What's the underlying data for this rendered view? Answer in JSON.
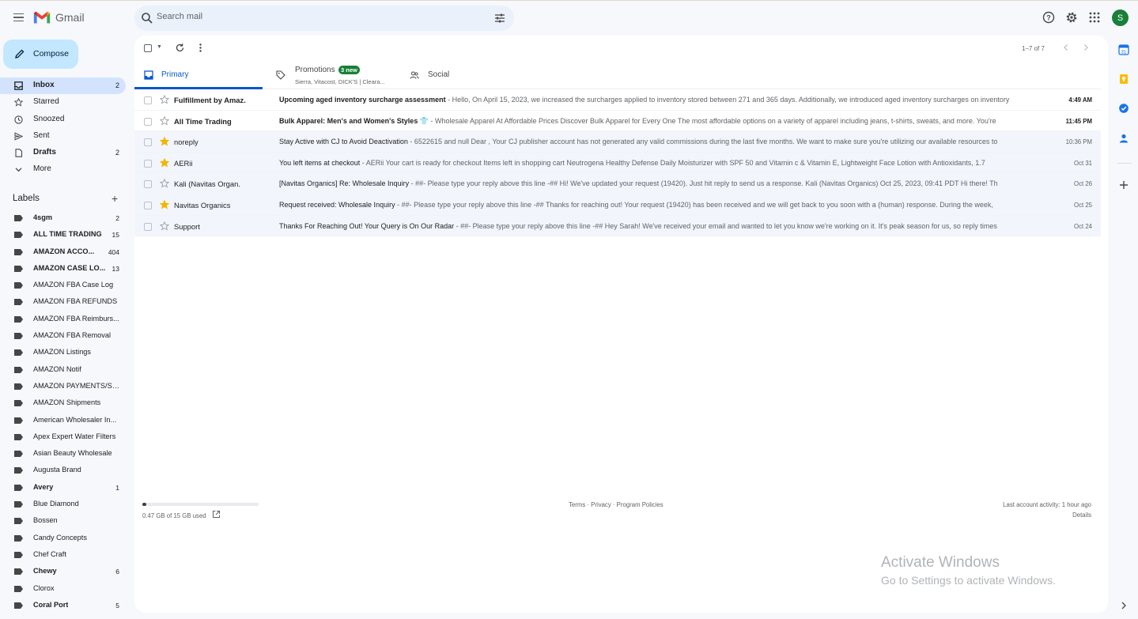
{
  "app": {
    "name": "Gmail"
  },
  "search": {
    "placeholder": "Search mail"
  },
  "user": {
    "initial": "S"
  },
  "compose": {
    "label": "Compose"
  },
  "nav": [
    {
      "label": "Inbox",
      "count": "2",
      "icon": "inbox-icon"
    },
    {
      "label": "Starred",
      "count": "",
      "icon": "star-icon"
    },
    {
      "label": "Snoozed",
      "count": "",
      "icon": "clock-icon"
    },
    {
      "label": "Sent",
      "count": "",
      "icon": "send-icon"
    },
    {
      "label": "Drafts",
      "count": "2",
      "icon": "draft-icon"
    },
    {
      "label": "More",
      "count": "",
      "icon": "chevron-down-icon"
    }
  ],
  "labels_header": "Labels",
  "labels": [
    {
      "name": "4sgm",
      "count": "2",
      "bold": true
    },
    {
      "name": "ALL TIME TRADING",
      "count": "15",
      "bold": true
    },
    {
      "name": "AMAZON ACCO...",
      "count": "404",
      "bold": true
    },
    {
      "name": "AMAZON CASE LO...",
      "count": "13",
      "bold": true
    },
    {
      "name": "AMAZON FBA Case Log",
      "count": "",
      "bold": false
    },
    {
      "name": "AMAZON FBA REFUNDS",
      "count": "",
      "bold": false
    },
    {
      "name": "AMAZON FBA Reimburs...",
      "count": "",
      "bold": false
    },
    {
      "name": "AMAZON FBA Removal",
      "count": "",
      "bold": false
    },
    {
      "name": "AMAZON Listings",
      "count": "",
      "bold": false
    },
    {
      "name": "AMAZON Notif",
      "count": "",
      "bold": false
    },
    {
      "name": "AMAZON PAYMENTS/SE...",
      "count": "",
      "bold": false
    },
    {
      "name": "AMAZON Shipments",
      "count": "",
      "bold": false
    },
    {
      "name": "American Wholesaler In...",
      "count": "",
      "bold": false
    },
    {
      "name": "Apex Expert Water Filters",
      "count": "",
      "bold": false
    },
    {
      "name": "Asian Beauty Wholesale",
      "count": "",
      "bold": false
    },
    {
      "name": "Augusta Brand",
      "count": "",
      "bold": false
    },
    {
      "name": "Avery",
      "count": "1",
      "bold": true
    },
    {
      "name": "Blue Diamond",
      "count": "",
      "bold": false
    },
    {
      "name": "Bossen",
      "count": "",
      "bold": false
    },
    {
      "name": "Candy Concepts",
      "count": "",
      "bold": false
    },
    {
      "name": "Chef Craft",
      "count": "",
      "bold": false
    },
    {
      "name": "Chewy",
      "count": "6",
      "bold": true
    },
    {
      "name": "Clorox",
      "count": "",
      "bold": false
    },
    {
      "name": "Coral Port",
      "count": "5",
      "bold": true
    }
  ],
  "pager": {
    "text": "1–7 of 7"
  },
  "tabs": [
    {
      "label": "Primary",
      "badge": "",
      "sub": ""
    },
    {
      "label": "Promotions",
      "badge": "3 new",
      "sub": "Sierra, Vitacost, DICK'S | Cleara..."
    },
    {
      "label": "Social",
      "badge": "",
      "sub": ""
    }
  ],
  "emails": [
    {
      "sender": "Fulfillment by Amaz.",
      "subject": "Upcoming aged inventory surcharge assessment",
      "snippet": " - Hello, On April 15, 2023, we increased the surcharges applied to inventory stored between 271 and 365 days. Additionally, we introduced aged inventory surcharges on inventory",
      "date": "4:49 AM",
      "unread": true,
      "starred": false
    },
    {
      "sender": "All Time Trading",
      "subject": "Bulk Apparel: Men's and Women's Styles 👕",
      "snippet": " - Wholesale Apparel At Affordable Prices Discover Bulk Apparel for Every One The most affordable options on a variety of apparel including jeans, t-shirts, sweats, and more. You're",
      "date": "11:45 PM",
      "unread": true,
      "starred": false
    },
    {
      "sender": "noreply",
      "subject": "Stay Active with CJ to Avoid Deactivation",
      "snippet": " - 6522615 and null Dear , Your CJ publisher account has not generated any valid commissions during the last five months. We want to make sure you're utilizing our available resources to",
      "date": "10:36 PM",
      "unread": false,
      "starred": true
    },
    {
      "sender": "AERii",
      "subject": "You left items at checkout",
      "snippet": " - AERii Your cart is ready for checkout Items left in shopping cart Neutrogena Healthy Defense Daily Moisturizer with SPF 50 and Vitamin c & Vitamin E, Lightweight Face Lotion with Antioxidants, 1.7",
      "date": "Oct 31",
      "unread": false,
      "starred": true
    },
    {
      "sender": "Kali (Navitas Organ.",
      "subject": "[Navitas Organics] Re: Wholesale Inquiry",
      "snippet": " - ##- Please type your reply above this line -## Hi! We've updated your request (19420). Just hit reply to send us a response. Kali (Navitas Organics) Oct 25, 2023, 09:41 PDT Hi there! Th",
      "date": "Oct 26",
      "unread": false,
      "starred": false
    },
    {
      "sender": "Navitas Organics",
      "subject": "Request received: Wholesale Inquiry",
      "snippet": " - ##- Please type your reply above this line -## Thanks for reaching out! Your request (19420) has been received and we will get back to you soon with a (human) response. During the week,",
      "date": "Oct 25",
      "unread": false,
      "starred": true
    },
    {
      "sender": "Support",
      "subject": "Thanks For Reaching Out! Your Query is On Our Radar",
      "snippet": " - ##- Please type your reply above this line -## Hey Sarah! We've received your email and wanted to let you know we're working on it. It's peak season for us, so reply times",
      "date": "Oct 24",
      "unread": false,
      "starred": false
    }
  ],
  "storage": {
    "text": "0.47 GB of 15 GB used",
    "fraction": 0.031
  },
  "footer": {
    "terms": "Terms",
    "privacy": "Privacy",
    "policies": "Program Policies",
    "sep": " · "
  },
  "activity": {
    "text": "Last account activity: 1 hour ago",
    "details": "Details"
  },
  "watermark": {
    "line1": "Activate Windows",
    "line2": "Go to Settings to activate Windows."
  },
  "colors": {
    "accent": "#0b57d0",
    "compose_bg": "#c2e7ff",
    "active_nav": "#d3e3fd",
    "star": "#f4b400",
    "badge": "#188038"
  }
}
